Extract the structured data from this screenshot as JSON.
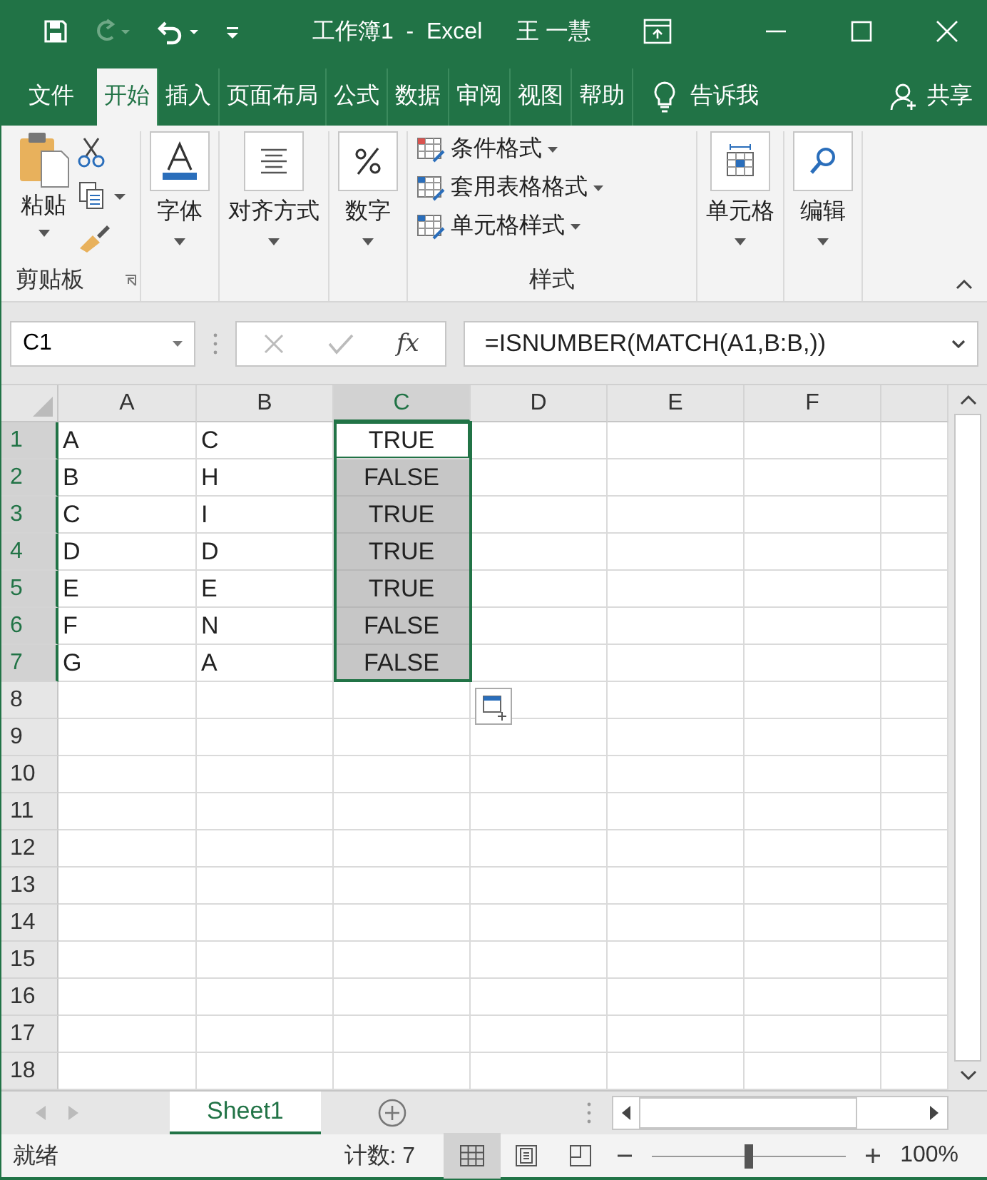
{
  "title_bar": {
    "title": "工作簿1  -  Excel",
    "user": "王 一慧"
  },
  "ribbon_tabs": [
    {
      "label": "文件",
      "selected": false
    },
    {
      "label": "开始",
      "selected": true
    },
    {
      "label": "插入",
      "selected": false
    },
    {
      "label": "页面布局",
      "selected": false
    },
    {
      "label": "公式",
      "selected": false
    },
    {
      "label": "数据",
      "selected": false
    },
    {
      "label": "审阅",
      "selected": false
    },
    {
      "label": "视图",
      "selected": false
    },
    {
      "label": "帮助",
      "selected": false
    }
  ],
  "tell_me": "告诉我",
  "share": "共享",
  "ribbon": {
    "paste": "粘贴",
    "clipboard_label": "剪贴板",
    "font": "字体",
    "alignment": "对齐方式",
    "number": "数字",
    "styles": [
      "条件格式",
      "套用表格格式",
      "单元格样式"
    ],
    "styles_label": "样式",
    "cells": "单元格",
    "editing": "编辑"
  },
  "name_box": "C1",
  "fx": "fx",
  "formula": "=ISNUMBER(MATCH(A1,B:B,))",
  "columns": [
    {
      "label": "A",
      "selected": false
    },
    {
      "label": "B",
      "selected": false
    },
    {
      "label": "C",
      "selected": true
    },
    {
      "label": "D",
      "selected": false
    },
    {
      "label": "E",
      "selected": false
    },
    {
      "label": "F",
      "selected": false
    }
  ],
  "rows": [
    {
      "label": "1",
      "selected": true,
      "active": true,
      "cells": [
        "A",
        "C",
        "TRUE"
      ]
    },
    {
      "label": "2",
      "selected": true,
      "active": false,
      "cells": [
        "B",
        "H",
        "FALSE"
      ]
    },
    {
      "label": "3",
      "selected": true,
      "active": false,
      "cells": [
        "C",
        "I",
        "TRUE"
      ]
    },
    {
      "label": "4",
      "selected": true,
      "active": false,
      "cells": [
        "D",
        "D",
        "TRUE"
      ]
    },
    {
      "label": "5",
      "selected": true,
      "active": false,
      "cells": [
        "E",
        "E",
        "TRUE"
      ]
    },
    {
      "label": "6",
      "selected": true,
      "active": false,
      "cells": [
        "F",
        "N",
        "FALSE"
      ]
    },
    {
      "label": "7",
      "selected": true,
      "active": false,
      "cells": [
        "G",
        "A",
        "FALSE"
      ]
    },
    {
      "label": "8",
      "selected": false,
      "active": false,
      "cells": []
    },
    {
      "label": "9",
      "selected": false,
      "active": false,
      "cells": []
    },
    {
      "label": "10",
      "selected": false,
      "active": false,
      "cells": []
    },
    {
      "label": "11",
      "selected": false,
      "active": false,
      "cells": []
    },
    {
      "label": "12",
      "selected": false,
      "active": false,
      "cells": []
    },
    {
      "label": "13",
      "selected": false,
      "active": false,
      "cells": []
    },
    {
      "label": "14",
      "selected": false,
      "active": false,
      "cells": []
    },
    {
      "label": "15",
      "selected": false,
      "active": false,
      "cells": []
    },
    {
      "label": "16",
      "selected": false,
      "active": false,
      "cells": []
    },
    {
      "label": "17",
      "selected": false,
      "active": false,
      "cells": []
    },
    {
      "label": "18",
      "selected": false,
      "active": false,
      "cells": []
    }
  ],
  "sheet_tabs": [
    {
      "label": "Sheet1",
      "selected": true
    }
  ],
  "status_bar": {
    "ready": "就绪",
    "count": "计数: 7",
    "zoom": "100%",
    "level": 0.5
  }
}
